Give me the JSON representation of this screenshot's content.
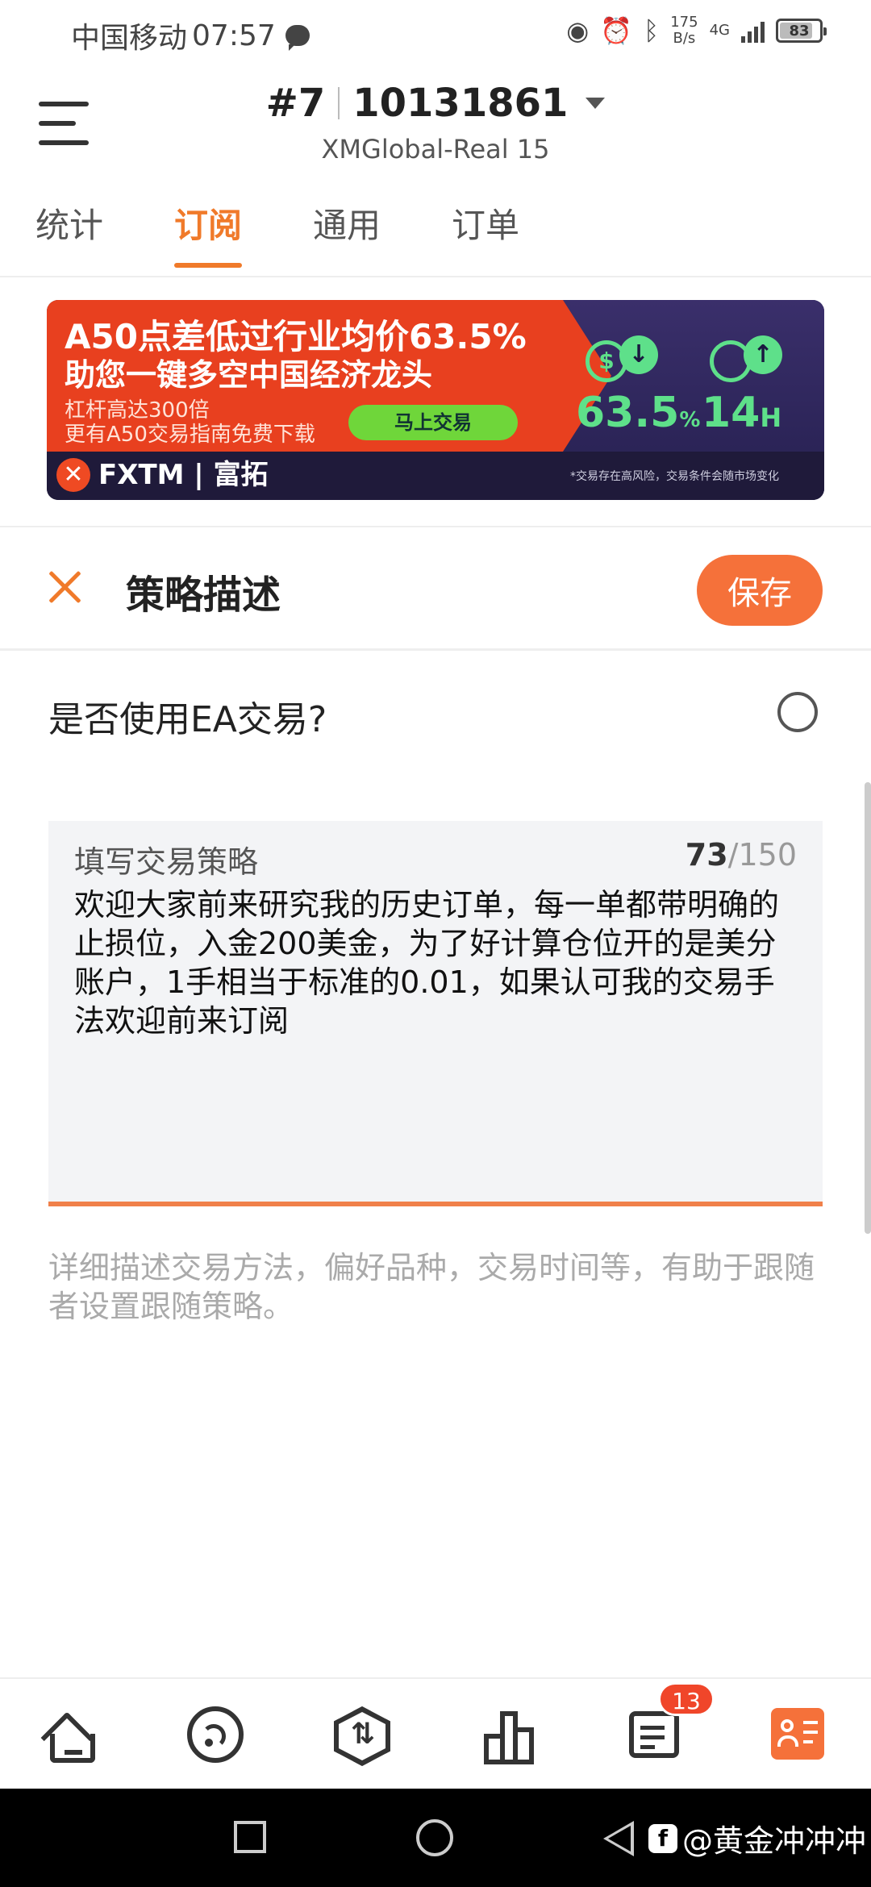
{
  "status_bar": {
    "carrier": "中国移动",
    "time": "07:57",
    "net_speed_value": "175",
    "net_speed_unit": "B/s",
    "network": "4G",
    "battery": "83",
    "battery_level": 0.83
  },
  "header": {
    "account_index": "#7",
    "account_number": "10131861",
    "server": "XMGlobal-Real 15"
  },
  "tabs": [
    {
      "label": "统计",
      "active": false
    },
    {
      "label": "订阅",
      "active": true
    },
    {
      "label": "通用",
      "active": false
    },
    {
      "label": "订单",
      "active": false
    }
  ],
  "banner": {
    "headline_1": "A50点差低过行业均价63.5%",
    "headline_2": "助您一键多空中国经济龙头",
    "sub_1": "杠杆高达300倍",
    "sub_2": "更有A50交易指南免费下载",
    "cta": "马上交易",
    "stat_1": "63.5",
    "stat_1_unit": "%",
    "stat_2": "14",
    "stat_2_unit": "H",
    "icon_1_symbol": "$",
    "icon_2_symbol": "↓",
    "icon_3_symbol": "↑",
    "brand": "FXTM",
    "brand_cn": "富拓",
    "disclaimer": "*交易存在高风险，交易条件会随市场变化"
  },
  "strategy": {
    "title": "策略描述",
    "save_label": "保存",
    "ea_question": "是否使用EA交易?",
    "field_label": "填写交易策略",
    "char_count": "73",
    "char_max": "/150",
    "text": "欢迎大家前来研究我的历史订单，每一单都带明确的止损位，入金200美金，为了好计算仓位开的是美分账户，1手相当于标准的0.01，如果认可我的交易手法欢迎前来订阅",
    "hint": "详细描述交易方法，偏好品种，交易时间等，有助于跟随者设置跟随策略。"
  },
  "bottom_nav": {
    "badge_count": "13",
    "items": [
      "home-icon",
      "feed-icon",
      "trade-icon",
      "chart-icon",
      "message-icon",
      "profile-card-icon"
    ],
    "accent": "#f5713a"
  },
  "watermark": "@黄金冲冲冲",
  "colors": {
    "accent": "#f07a2a",
    "save_button": "#f5713a",
    "banner_red": "#e8401f",
    "banner_green": "#5ee08a"
  }
}
